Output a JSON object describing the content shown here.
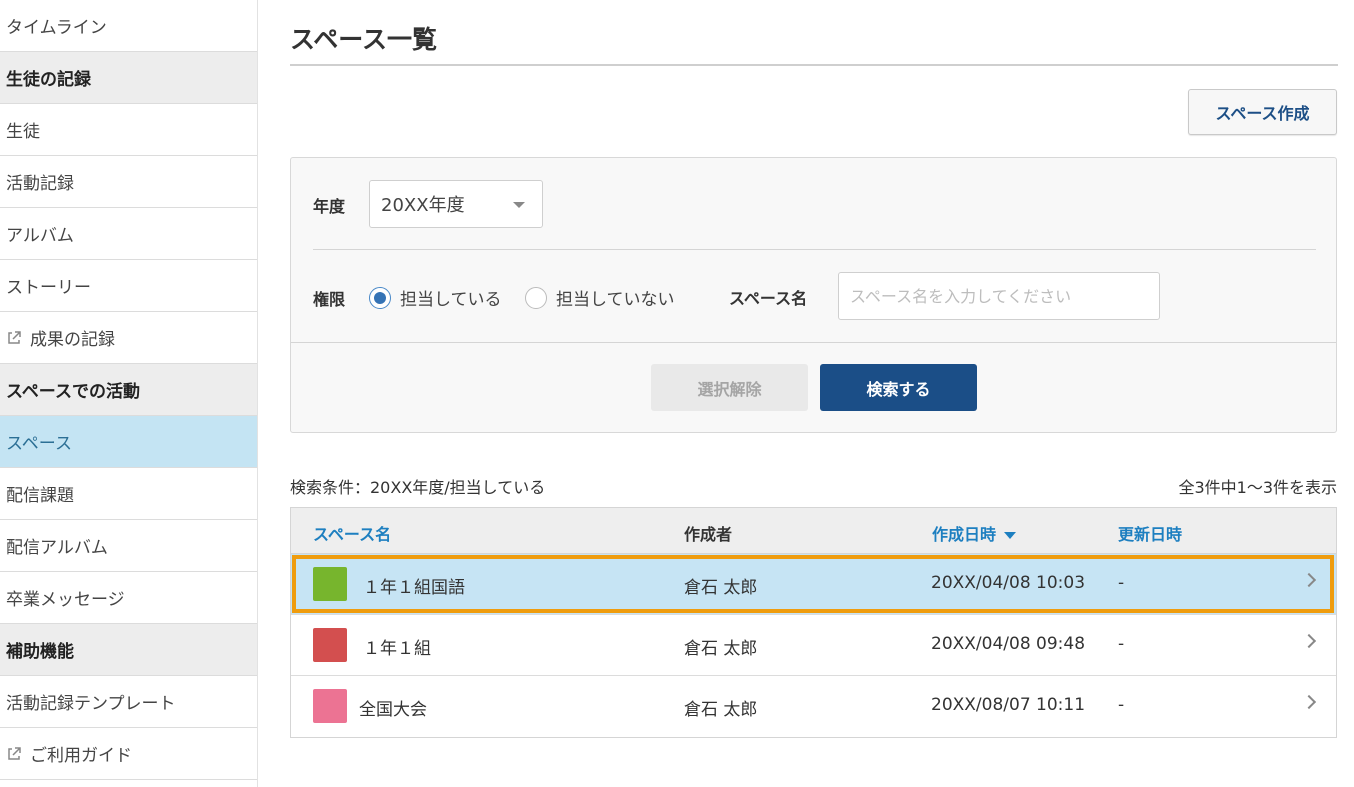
{
  "sidebar": {
    "items": [
      {
        "label": "タイムライン",
        "type": "item"
      },
      {
        "label": "生徒の記録",
        "type": "section"
      },
      {
        "label": "生徒",
        "type": "item"
      },
      {
        "label": "活動記録",
        "type": "item"
      },
      {
        "label": "アルバム",
        "type": "item"
      },
      {
        "label": "ストーリー",
        "type": "item"
      },
      {
        "label": "成果の記録",
        "type": "external"
      },
      {
        "label": "スペースでの活動",
        "type": "section"
      },
      {
        "label": "スペース",
        "type": "active"
      },
      {
        "label": "配信課題",
        "type": "item"
      },
      {
        "label": "配信アルバム",
        "type": "item"
      },
      {
        "label": "卒業メッセージ",
        "type": "item"
      },
      {
        "label": "補助機能",
        "type": "section"
      },
      {
        "label": "活動記録テンプレート",
        "type": "item"
      },
      {
        "label": "ご利用ガイド",
        "type": "external"
      }
    ]
  },
  "main": {
    "title": "スペース一覧",
    "create_button": "スペース作成"
  },
  "filter": {
    "year_label": "年度",
    "year_value": "20XX年度",
    "permission_label": "権限",
    "radio_assigned": "担当している",
    "radio_unassigned": "担当していない",
    "selected_radio": "担当している",
    "name_label": "スペース名",
    "name_placeholder": "スペース名を入力してください",
    "clear_button": "選択解除",
    "search_button": "検索する"
  },
  "results": {
    "condition": "検索条件：20XX年度/担当している",
    "count": "全3件中1～3件を表示",
    "columns": {
      "name": "スペース名",
      "creator": "作成者",
      "created": "作成日時",
      "updated": "更新日時"
    },
    "rows": [
      {
        "name": "１年１組国語",
        "creator": "倉石 太郎",
        "created": "20XX/04/08 10:03",
        "updated": "-",
        "color": "#77b52d",
        "selected": true
      },
      {
        "name": "１年１組",
        "creator": "倉石 太郎",
        "created": "20XX/04/08 09:48",
        "updated": "-",
        "color": "#d34f4f",
        "selected": false
      },
      {
        "name": "全国大会",
        "creator": "倉石 太郎",
        "created": "20XX/08/07 10:11",
        "updated": "-",
        "color": "#ec7393",
        "selected": false
      }
    ]
  },
  "colors": {
    "accent": "#1b4e87",
    "link": "#1d7fc0",
    "active_nav": "#c4e4f3",
    "highlight": "#ef9c0e"
  }
}
